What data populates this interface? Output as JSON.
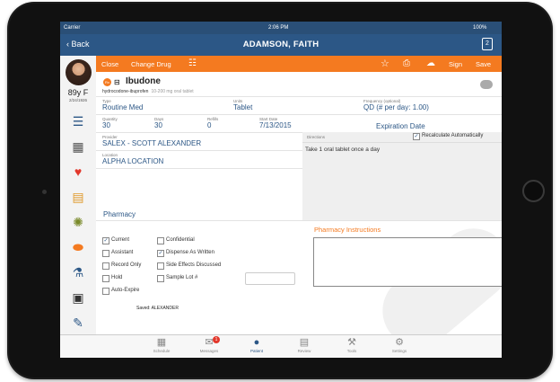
{
  "status": {
    "carrier": "Carrier",
    "time": "2:06 PM",
    "battery": "100%"
  },
  "nav": {
    "back": "Back",
    "title": "ADAMSON, FAITH",
    "page_icon": "2"
  },
  "patient": {
    "age_sex": "89y F",
    "dob": "2/24/1926"
  },
  "sidebar_icons": [
    "contacts-icon",
    "calendar-icon",
    "heart-pulse-icon",
    "document-icon",
    "virus-icon",
    "pill-icon",
    "test-tube-icon",
    "image-icon",
    "syringe-icon"
  ],
  "toolbar": {
    "close": "Close",
    "change_drug": "Change Drug",
    "sign": "Sign",
    "save": "Save"
  },
  "drug": {
    "badge": "Rx",
    "name": "Ibudone",
    "generic": "hydrocodone-ibuprofen",
    "strength": "10-200 mg oral tablet"
  },
  "form": {
    "type": {
      "label": "Type",
      "value": "Routine Med"
    },
    "units": {
      "label": "Units",
      "value": "Tablet"
    },
    "frequency": {
      "label": "Frequency (optional)",
      "value": "QD (# per day: 1.00)"
    },
    "quantity": {
      "label": "Quantity",
      "value": "30"
    },
    "days": {
      "label": "Days",
      "value": "30"
    },
    "refills": {
      "label": "Refills",
      "value": "0"
    },
    "start_date": {
      "label": "Start Date",
      "value": "7/13/2015"
    },
    "expiration": "Expiration Date",
    "provider": {
      "label": "Provider",
      "value": "SALEX - SCOTT ALEXANDER"
    },
    "location": {
      "label": "Location",
      "value": "ALPHA LOCATION"
    },
    "directions": {
      "label": "Directions",
      "recalc": "Recalculate Automatically",
      "text": "Take 1 oral tablet once a day"
    },
    "pharmacy": "Pharmacy"
  },
  "checkboxes": {
    "current": "Current",
    "assistant": "Assistant",
    "record_only": "Record Only",
    "hold": "Hold",
    "auto_expire": "Auto-Expire",
    "confidential": "Confidential",
    "daw": "Dispense As Written",
    "side_effects": "Side Effects Discussed",
    "sample_lot": "Sample Lot #"
  },
  "pharmacy_instructions": "Pharmacy Instructions",
  "saved": "Saved: ALEXANDER",
  "tabs": [
    {
      "label": "Schedule",
      "icon": "calendar-icon"
    },
    {
      "label": "Messages",
      "icon": "message-icon",
      "badge": "1"
    },
    {
      "label": "Patient",
      "icon": "person-icon"
    },
    {
      "label": "Review",
      "icon": "clipboard-icon"
    },
    {
      "label": "Tools",
      "icon": "hammer-icon"
    },
    {
      "label": "Settings",
      "icon": "gear-icon"
    }
  ],
  "colors": {
    "accent": "#f47a20",
    "nav": "#2c5786",
    "link": "#2c5786"
  }
}
